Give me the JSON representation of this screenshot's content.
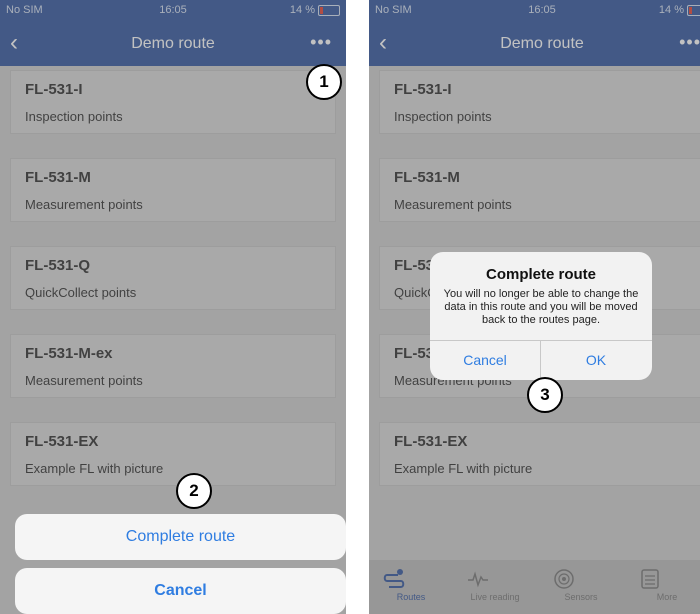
{
  "status": {
    "carrier": "No SIM",
    "time": "16:05",
    "battery": "14 %"
  },
  "nav": {
    "title": "Demo route",
    "back_icon": "‹",
    "more_icon": "•••"
  },
  "routes": [
    {
      "code": "FL-531-I",
      "desc": "Inspection points"
    },
    {
      "code": "FL-531-M",
      "desc": "Measurement points"
    },
    {
      "code": "FL-531-Q",
      "desc": "QuickCollect points"
    },
    {
      "code": "FL-531-M-ex",
      "desc": "Measurement points"
    },
    {
      "code": "FL-531-EX",
      "desc": "Example FL with picture"
    }
  ],
  "sheet": {
    "complete_label": "Complete route",
    "cancel_label": "Cancel"
  },
  "dialog": {
    "title": "Complete route",
    "message": "You will no longer be able to change the data in this route and you will be moved back to the routes page.",
    "cancel_label": "Cancel",
    "ok_label": "OK"
  },
  "callouts": {
    "one": "1",
    "two": "2",
    "three": "3"
  },
  "tabs": [
    {
      "label": "Routes",
      "icon": "routes-icon"
    },
    {
      "label": "Live reading",
      "icon": "live-reading-icon"
    },
    {
      "label": "Sensors",
      "icon": "sensor-icon"
    },
    {
      "label": "More",
      "icon": "more-menu-icon"
    }
  ],
  "colors": {
    "brand": "#3d5fa3",
    "link": "#2f7de1"
  }
}
